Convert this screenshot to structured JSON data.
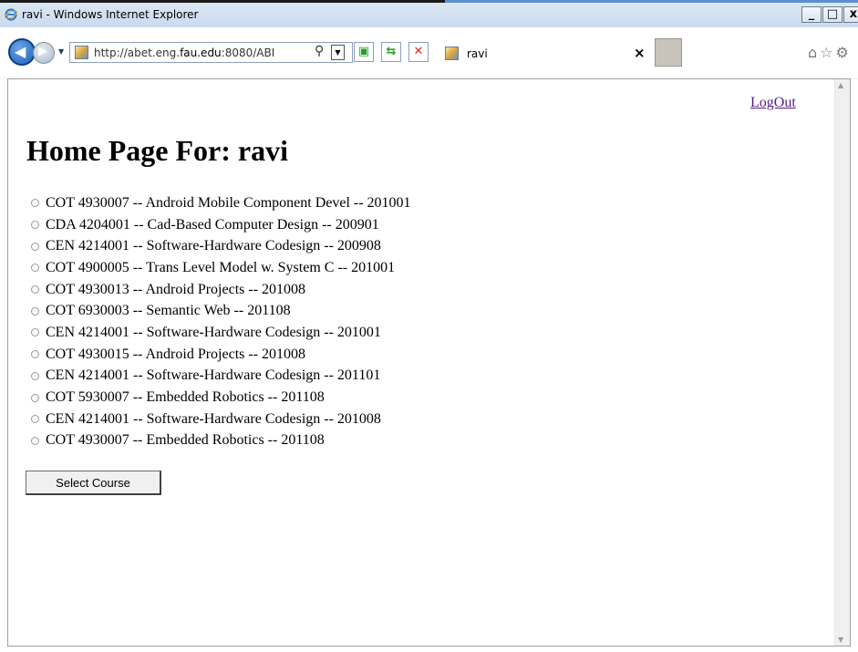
{
  "window": {
    "title": "ravi - Windows Internet Explorer",
    "controls": {
      "minimize": "_",
      "maximize": "□",
      "close": "x"
    }
  },
  "navbar": {
    "url_prefix": "http://abet.eng.",
    "url_domain": "fau.edu",
    "url_suffix": ":8080/ABI",
    "tab_title": "ravi",
    "tab_close": "×"
  },
  "page": {
    "logout": "LogOut",
    "heading": "Home Page For: ravi",
    "courses": [
      "COT 4930007 -- Android Mobile Component Devel -- 201001",
      "CDA 4204001 -- Cad-Based Computer Design -- 200901",
      "CEN 4214001 -- Software-Hardware Codesign -- 200908",
      "COT 4900005 -- Trans Level Model w. System C -- 201001",
      "COT 4930013 -- Android Projects -- 201008",
      "COT 6930003 -- Semantic Web -- 201108",
      "CEN 4214001 -- Software-Hardware Codesign -- 201001",
      "COT 4930015 -- Android Projects -- 201008",
      "CEN 4214001 -- Software-Hardware Codesign -- 201101",
      "COT 5930007 -- Embedded Robotics -- 201108",
      "CEN 4214001 -- Software-Hardware Codesign -- 201008",
      "COT 4930007 -- Embedded Robotics -- 201108"
    ],
    "select_button": "Select Course"
  },
  "colors": {
    "visited_link": "#551a8b",
    "titlebar": "#c9daee"
  },
  "icons": [
    "ie-logo-icon",
    "back-arrow-icon",
    "forward-arrow-icon",
    "page-favicon-icon",
    "search-icon",
    "compatibility-view-icon",
    "refresh-icon",
    "stop-icon",
    "home-icon",
    "favorites-star-icon",
    "gear-icon"
  ]
}
